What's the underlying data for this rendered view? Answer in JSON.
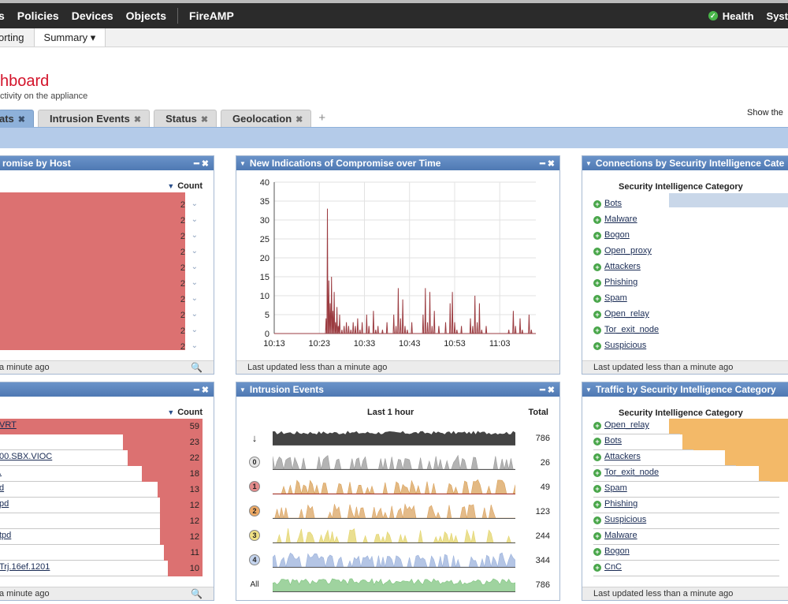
{
  "nav": {
    "items": [
      "s",
      "Policies",
      "Devices",
      "Objects"
    ],
    "fireamp": "FireAMP",
    "health": "Health",
    "system": "Syst"
  },
  "subnav": {
    "reporting": "orting",
    "summary": "Summary ▾"
  },
  "header": {
    "title": "hboard",
    "subtitle": "ctivity on the appliance",
    "show": "Show the"
  },
  "tabs": [
    {
      "label": "ats",
      "active": true
    },
    {
      "label": "Intrusion Events"
    },
    {
      "label": "Status"
    },
    {
      "label": "Geolocation"
    }
  ],
  "tab_close": "✖",
  "tab_add": "+",
  "widgets": {
    "ioc_host": {
      "title": "romise by Host",
      "count_label": "Count",
      "counts": [
        "2",
        "2",
        "2",
        "2",
        "2",
        "2",
        "2",
        "2",
        "2",
        "2"
      ],
      "footer": "a minute ago"
    },
    "ioc_time": {
      "title": "New Indications of Compromise over Time",
      "footer": "Last updated less than a minute ago"
    },
    "conn_si": {
      "title": "Connections by Security Intelligence Cate",
      "col_header": "Security Intelligence Category",
      "categories": [
        "Bots",
        "Malware",
        "Bogon",
        "Open_proxy",
        "Attackers",
        "Phishing",
        "Spam",
        "Open_relay",
        "Tor_exit_node",
        "Suspicious"
      ],
      "footer": "Last updated less than a minute ago"
    },
    "sigs": {
      "title": "",
      "count_label": "Count",
      "rows": [
        {
          "label": "VRT",
          "count": "59",
          "frac": 1.0
        },
        {
          "label": "",
          "count": "23",
          "frac": 0.39
        },
        {
          "label": "00.SBX.VIOC",
          "count": "22",
          "frac": 0.37
        },
        {
          "label": ".",
          "count": "18",
          "frac": 0.3
        },
        {
          "label": "d",
          "count": "13",
          "frac": 0.22
        },
        {
          "label": "pd",
          "count": "12",
          "frac": 0.21
        },
        {
          "label": "",
          "count": "12",
          "frac": 0.21
        },
        {
          "label": "tpd",
          "count": "12",
          "frac": 0.21
        },
        {
          "label": "",
          "count": "11",
          "frac": 0.19
        },
        {
          "label": "Trj.16ef.1201",
          "count": "10",
          "frac": 0.17
        }
      ],
      "footer": "a minute ago"
    },
    "intrusion": {
      "title": "Intrusion Events",
      "col_last": "Last 1 hour",
      "col_total": "Total",
      "rows": [
        {
          "badge": "↓",
          "total": "786",
          "color": "#444444",
          "badge_bg": "none"
        },
        {
          "badge": "0",
          "total": "26",
          "color": "#9a9a9a",
          "badge_bg": "#e6e6e6"
        },
        {
          "badge": "1",
          "total": "49",
          "color": "#d9a15a",
          "badge_bg": "#e28a8a"
        },
        {
          "badge": "2",
          "total": "123",
          "color": "#dba461",
          "badge_bg": "#eeaa66"
        },
        {
          "badge": "3",
          "total": "244",
          "color": "#e3d46b",
          "badge_bg": "#efe083"
        },
        {
          "badge": "4",
          "total": "344",
          "color": "#9bb2dc",
          "badge_bg": "#c4d4ee"
        },
        {
          "badge": "All",
          "total": "786",
          "color": "#7fc47f",
          "badge_bg": "none"
        }
      ]
    },
    "traffic_si": {
      "title": "Traffic by Security Intelligence Category",
      "col_header": "Security Intelligence Category",
      "categories": [
        {
          "label": "Open_relay",
          "frac": 1.0
        },
        {
          "label": "Bots",
          "frac": 0.89
        },
        {
          "label": "Attackers",
          "frac": 0.54
        },
        {
          "label": "Tor_exit_node",
          "frac": 0.26
        },
        {
          "label": "Spam",
          "frac": 0
        },
        {
          "label": "Phishing",
          "frac": 0
        },
        {
          "label": "Suspicious",
          "frac": 0
        },
        {
          "label": "Malware",
          "frac": 0
        },
        {
          "label": "Bogon",
          "frac": 0
        },
        {
          "label": "CnC",
          "frac": 0
        }
      ],
      "footer": "Last updated less than a minute ago"
    }
  },
  "chart_data": {
    "type": "line",
    "x_ticks": [
      "10:13",
      "10:23",
      "10:33",
      "10:43",
      "10:53",
      "11:03"
    ],
    "ylim": [
      0,
      40
    ],
    "y_ticks": [
      0,
      5,
      10,
      15,
      20,
      25,
      30,
      35,
      40
    ],
    "grid": true,
    "x": [
      0,
      0.5,
      1,
      1.5,
      2,
      2.5,
      3,
      3.5,
      4,
      4.5,
      5,
      5.5,
      6,
      6.5,
      7,
      7.5,
      8,
      8.5,
      9,
      9.5,
      10,
      10.5,
      11,
      11.5,
      12,
      12.5,
      13,
      13.5,
      14,
      14.5,
      15,
      15.5,
      16,
      16.5,
      17,
      17.5,
      18,
      18.5,
      19,
      19.5,
      20,
      20.5,
      21,
      21.5,
      22,
      22.5,
      23,
      23.5,
      24,
      24.5,
      25,
      25.5,
      26,
      26.5,
      27,
      27.5,
      28,
      28.5,
      29,
      29.5,
      30,
      30.5,
      31,
      31.5,
      32,
      32.5,
      33,
      33.5,
      34,
      34.5,
      35,
      35.5,
      36,
      36.5,
      37,
      37.5,
      38,
      38.5,
      39,
      39.5,
      40,
      40.5,
      41,
      41.5,
      42,
      42.5,
      43,
      43.5,
      44,
      44.5,
      45,
      45.5,
      46,
      46.5,
      47,
      47.5,
      48,
      48.5,
      49,
      49.5,
      50,
      50.5,
      51,
      51.5,
      52,
      52.5,
      53,
      53.5,
      54,
      54.5,
      55,
      55.5,
      56,
      56.5,
      57,
      57.5,
      58
    ],
    "values": [
      0,
      0,
      0,
      0,
      0,
      0,
      0,
      0,
      0,
      0,
      0,
      0,
      0,
      0,
      0,
      0,
      0,
      0,
      0,
      0,
      0,
      0,
      0,
      0,
      0,
      0,
      0,
      0,
      0,
      0,
      0,
      0,
      0,
      0,
      0,
      0,
      0,
      0,
      0,
      0,
      0,
      0,
      0,
      0,
      0,
      0,
      0,
      0,
      0,
      0,
      0,
      0,
      0,
      0,
      0,
      0,
      0,
      0,
      0,
      0,
      0,
      0,
      0,
      0,
      0,
      0,
      0,
      0,
      0,
      0,
      0,
      0,
      0,
      0,
      0,
      0,
      0,
      0,
      0,
      0,
      0,
      0,
      0,
      0,
      0,
      0,
      0,
      0,
      0,
      0,
      0,
      0,
      0,
      0,
      0,
      0,
      0,
      0,
      0,
      0,
      0,
      0,
      0,
      0,
      0,
      0,
      0,
      0,
      0,
      0,
      0,
      0,
      0,
      0,
      0,
      0,
      0
    ],
    "spikes": [
      [
        11.5,
        4
      ],
      [
        11.8,
        33
      ],
      [
        12.1,
        14
      ],
      [
        12.4,
        8
      ],
      [
        12.7,
        15
      ],
      [
        13.0,
        6
      ],
      [
        13.3,
        11
      ],
      [
        13.6,
        3
      ],
      [
        13.9,
        7
      ],
      [
        14.2,
        2
      ],
      [
        14.5,
        5
      ],
      [
        15.0,
        1
      ],
      [
        15.5,
        2
      ],
      [
        16.0,
        3
      ],
      [
        16.5,
        2
      ],
      [
        17.0,
        1
      ],
      [
        17.5,
        3
      ],
      [
        18.0,
        2
      ],
      [
        18.5,
        4
      ],
      [
        19.0,
        1
      ],
      [
        19.5,
        3
      ],
      [
        20.5,
        5
      ],
      [
        21.0,
        2
      ],
      [
        22.0,
        6
      ],
      [
        22.5,
        1
      ],
      [
        23.0,
        2
      ],
      [
        24.0,
        1
      ],
      [
        25.0,
        3
      ],
      [
        26.5,
        5
      ],
      [
        27.0,
        2
      ],
      [
        27.5,
        12
      ],
      [
        28.0,
        4
      ],
      [
        28.5,
        9
      ],
      [
        29.0,
        2
      ],
      [
        29.5,
        1
      ],
      [
        30.5,
        3
      ],
      [
        33.0,
        5
      ],
      [
        33.5,
        12
      ],
      [
        34.0,
        3
      ],
      [
        34.5,
        11
      ],
      [
        35.0,
        2
      ],
      [
        35.5,
        6
      ],
      [
        36.5,
        2
      ],
      [
        38.0,
        3
      ],
      [
        39.0,
        8
      ],
      [
        39.5,
        11
      ],
      [
        40.0,
        3
      ],
      [
        40.5,
        1
      ],
      [
        41.5,
        2
      ],
      [
        43.5,
        4
      ],
      [
        44.0,
        2
      ],
      [
        44.5,
        10
      ],
      [
        45.0,
        3
      ],
      [
        45.5,
        8
      ],
      [
        46.0,
        1
      ],
      [
        47.0,
        2
      ],
      [
        52.0,
        1
      ],
      [
        53.0,
        6
      ],
      [
        53.5,
        2
      ],
      [
        54.5,
        4
      ],
      [
        55.0,
        1
      ],
      [
        56.5,
        5
      ],
      [
        57.0,
        1
      ]
    ]
  }
}
